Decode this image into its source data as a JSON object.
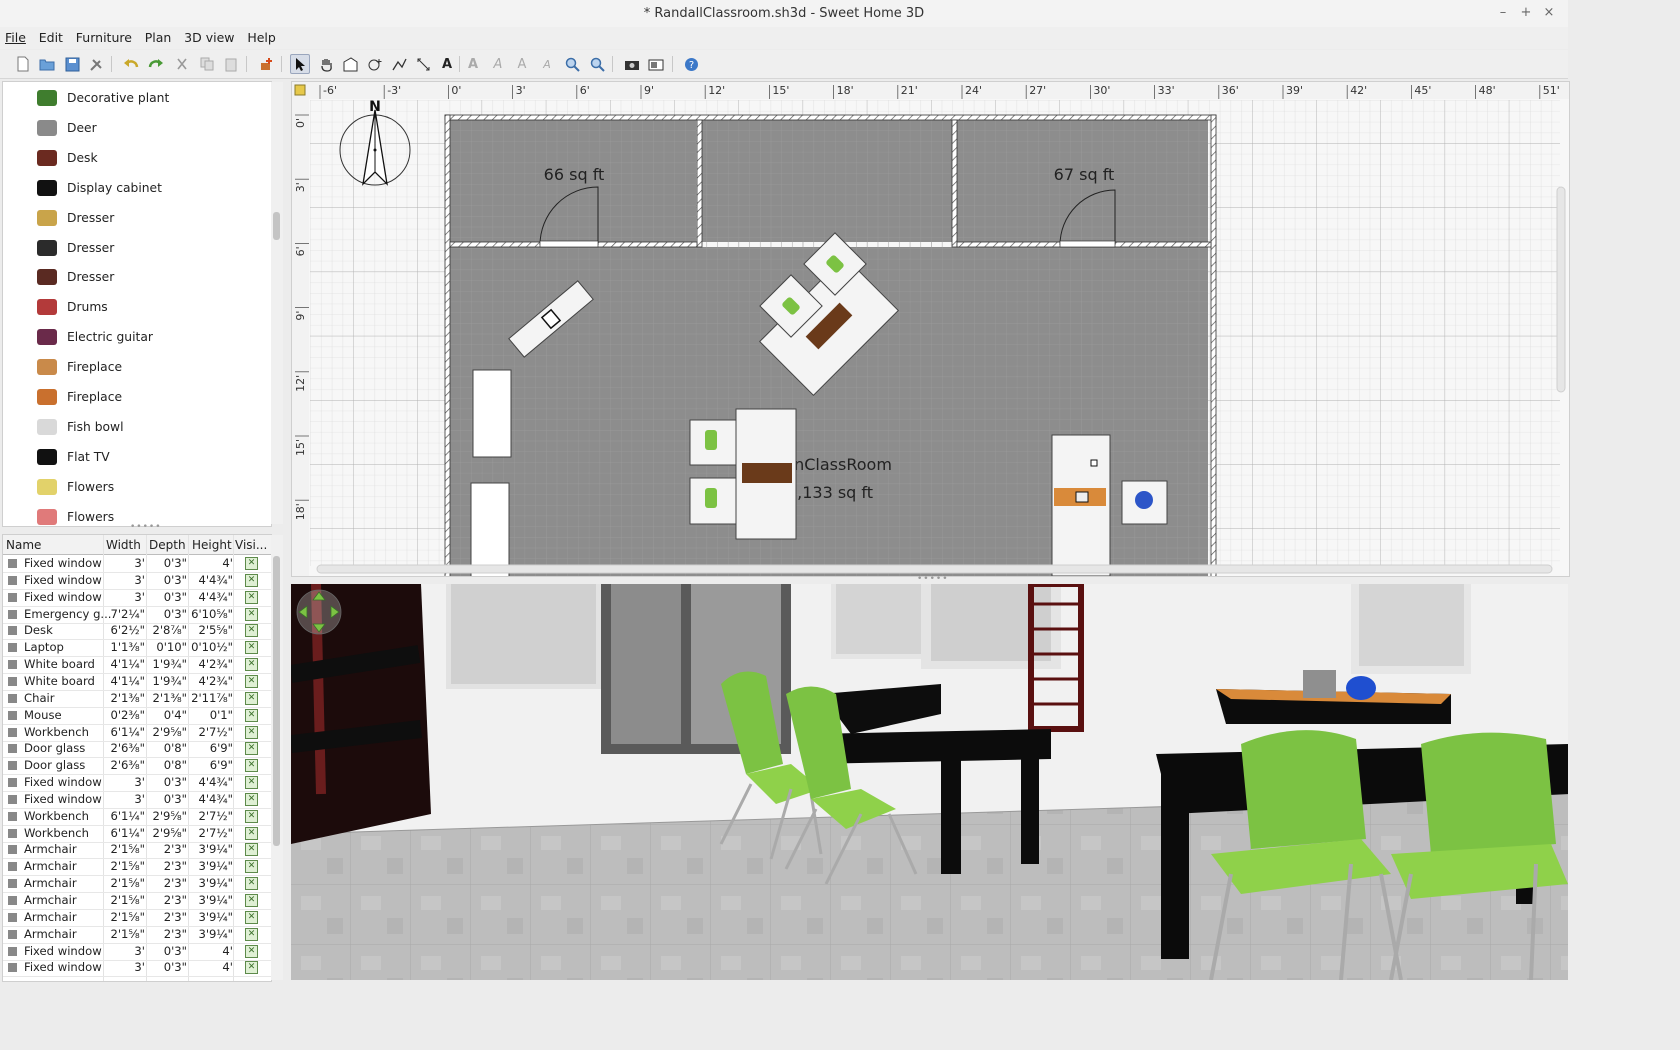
{
  "window": {
    "title": "* RandallClassroom.sh3d - Sweet Home 3D",
    "controls": [
      "–",
      "+",
      "×"
    ]
  },
  "menu": [
    "File",
    "Edit",
    "Furniture",
    "Plan",
    "3D view",
    "Help"
  ],
  "catalog": {
    "items": [
      {
        "label": "Decorative plant",
        "icon": "plant-icon",
        "color": "#3f7d2e"
      },
      {
        "label": "Deer",
        "icon": "deer-icon",
        "color": "#8a8a8a"
      },
      {
        "label": "Desk",
        "icon": "desk-icon",
        "color": "#6b2a20"
      },
      {
        "label": "Display cabinet",
        "icon": "cabinet-icon",
        "color": "#111111"
      },
      {
        "label": "Dresser",
        "icon": "dresser-icon",
        "color": "#c9a44a"
      },
      {
        "label": "Dresser",
        "icon": "dresser-icon",
        "color": "#2b2b2b"
      },
      {
        "label": "Dresser",
        "icon": "dresser-icon",
        "color": "#5a2a22"
      },
      {
        "label": "Drums",
        "icon": "drums-icon",
        "color": "#b33a3a"
      },
      {
        "label": "Electric guitar",
        "icon": "guitar-icon",
        "color": "#6a2a4a"
      },
      {
        "label": "Fireplace",
        "icon": "fireplace-icon",
        "color": "#c98a4a"
      },
      {
        "label": "Fireplace",
        "icon": "fireplace-icon",
        "color": "#c9702e"
      },
      {
        "label": "Fish bowl",
        "icon": "fishbowl-icon",
        "color": "#d9d9d9"
      },
      {
        "label": "Flat TV",
        "icon": "tv-icon",
        "color": "#111111"
      },
      {
        "label": "Flowers",
        "icon": "flowers-icon",
        "color": "#e2d26a"
      },
      {
        "label": "Flowers",
        "icon": "flowers-icon",
        "color": "#e07a7a"
      }
    ]
  },
  "furniture_table": {
    "headers": [
      "Name",
      "Width",
      "Depth",
      "Height",
      "Visi..."
    ],
    "rows": [
      {
        "name": "Fixed window",
        "width": "3'",
        "depth": "0'3\"",
        "height": "4'",
        "icon": "window-icon"
      },
      {
        "name": "Fixed window",
        "width": "3'",
        "depth": "0'3\"",
        "height": "4'4¾\"",
        "icon": "window-icon"
      },
      {
        "name": "Fixed window",
        "width": "3'",
        "depth": "0'3\"",
        "height": "4'4¾\"",
        "icon": "window-icon"
      },
      {
        "name": "Emergency g...",
        "width": "7'2¼\"",
        "depth": "0'3\"",
        "height": "6'10⅝\"",
        "icon": "door-icon"
      },
      {
        "name": "Desk",
        "width": "6'2½\"",
        "depth": "2'8⅞\"",
        "height": "2'5⅝\"",
        "icon": "desk-icon"
      },
      {
        "name": "Laptop",
        "width": "1'1⅜\"",
        "depth": "0'10\"",
        "height": "0'10½\"",
        "icon": "laptop-icon"
      },
      {
        "name": "White board",
        "width": "4'1¼\"",
        "depth": "1'9¾\"",
        "height": "4'2¾\"",
        "icon": "board-icon"
      },
      {
        "name": "White board",
        "width": "4'1¼\"",
        "depth": "1'9¾\"",
        "height": "4'2¾\"",
        "icon": "board-icon"
      },
      {
        "name": "Chair",
        "width": "2'1⅜\"",
        "depth": "2'1⅜\"",
        "height": "2'11⅞\"",
        "icon": "chair-icon"
      },
      {
        "name": "Mouse",
        "width": "0'2⅜\"",
        "depth": "0'4\"",
        "height": "0'1\"",
        "icon": "mouse-icon"
      },
      {
        "name": "Workbench",
        "width": "6'1¼\"",
        "depth": "2'9⅝\"",
        "height": "2'7½\"",
        "icon": "bench-icon"
      },
      {
        "name": "Door glass",
        "width": "2'6⅜\"",
        "depth": "0'8\"",
        "height": "6'9\"",
        "icon": "door-icon"
      },
      {
        "name": "Door glass",
        "width": "2'6⅜\"",
        "depth": "0'8\"",
        "height": "6'9\"",
        "icon": "door-icon"
      },
      {
        "name": "Fixed window",
        "width": "3'",
        "depth": "0'3\"",
        "height": "4'4¾\"",
        "icon": "window-icon"
      },
      {
        "name": "Fixed window",
        "width": "3'",
        "depth": "0'3\"",
        "height": "4'4¾\"",
        "icon": "window-icon"
      },
      {
        "name": "Workbench",
        "width": "6'1¼\"",
        "depth": "2'9⅝\"",
        "height": "2'7½\"",
        "icon": "bench-icon"
      },
      {
        "name": "Workbench",
        "width": "6'1¼\"",
        "depth": "2'9⅝\"",
        "height": "2'7½\"",
        "icon": "bench-icon"
      },
      {
        "name": "Armchair",
        "width": "2'1⅝\"",
        "depth": "2'3\"",
        "height": "3'9¼\"",
        "icon": "armchair-icon"
      },
      {
        "name": "Armchair",
        "width": "2'1⅝\"",
        "depth": "2'3\"",
        "height": "3'9¼\"",
        "icon": "armchair-icon"
      },
      {
        "name": "Armchair",
        "width": "2'1⅝\"",
        "depth": "2'3\"",
        "height": "3'9¼\"",
        "icon": "armchair-icon"
      },
      {
        "name": "Armchair",
        "width": "2'1⅝\"",
        "depth": "2'3\"",
        "height": "3'9¼\"",
        "icon": "armchair-icon"
      },
      {
        "name": "Armchair",
        "width": "2'1⅝\"",
        "depth": "2'3\"",
        "height": "3'9¼\"",
        "icon": "armchair-icon"
      },
      {
        "name": "Armchair",
        "width": "2'1⅝\"",
        "depth": "2'3\"",
        "height": "3'9¼\"",
        "icon": "armchair-icon"
      },
      {
        "name": "Fixed window",
        "width": "3'",
        "depth": "0'3\"",
        "height": "4'",
        "icon": "window-icon"
      },
      {
        "name": "Fixed window",
        "width": "3'",
        "depth": "0'3\"",
        "height": "4'",
        "icon": "window-icon"
      }
    ]
  },
  "plan": {
    "ruler_x": [
      "-6'",
      "-3'",
      "0'",
      "3'",
      "6'",
      "9'",
      "12'",
      "15'",
      "18'",
      "21'",
      "24'",
      "27'",
      "30'",
      "33'",
      "36'",
      "39'",
      "42'",
      "45'",
      "48'",
      "51'"
    ],
    "ruler_y": [
      "0'",
      "3'",
      "6'",
      "9'",
      "12'",
      "15'",
      "18'"
    ],
    "compass_label": "N",
    "rooms": [
      {
        "area": "66 sq ft"
      },
      {
        "area": "67 sq ft"
      },
      {
        "name": "MainClassRoom",
        "area": "1,133 sq ft"
      }
    ]
  },
  "colors": {
    "room_floor": "#8d8d8d",
    "wall": "#ffffff",
    "chair_green": "#7cc243",
    "table_black": "#0f0f0f",
    "floor_3d": "#bcbcbc"
  }
}
